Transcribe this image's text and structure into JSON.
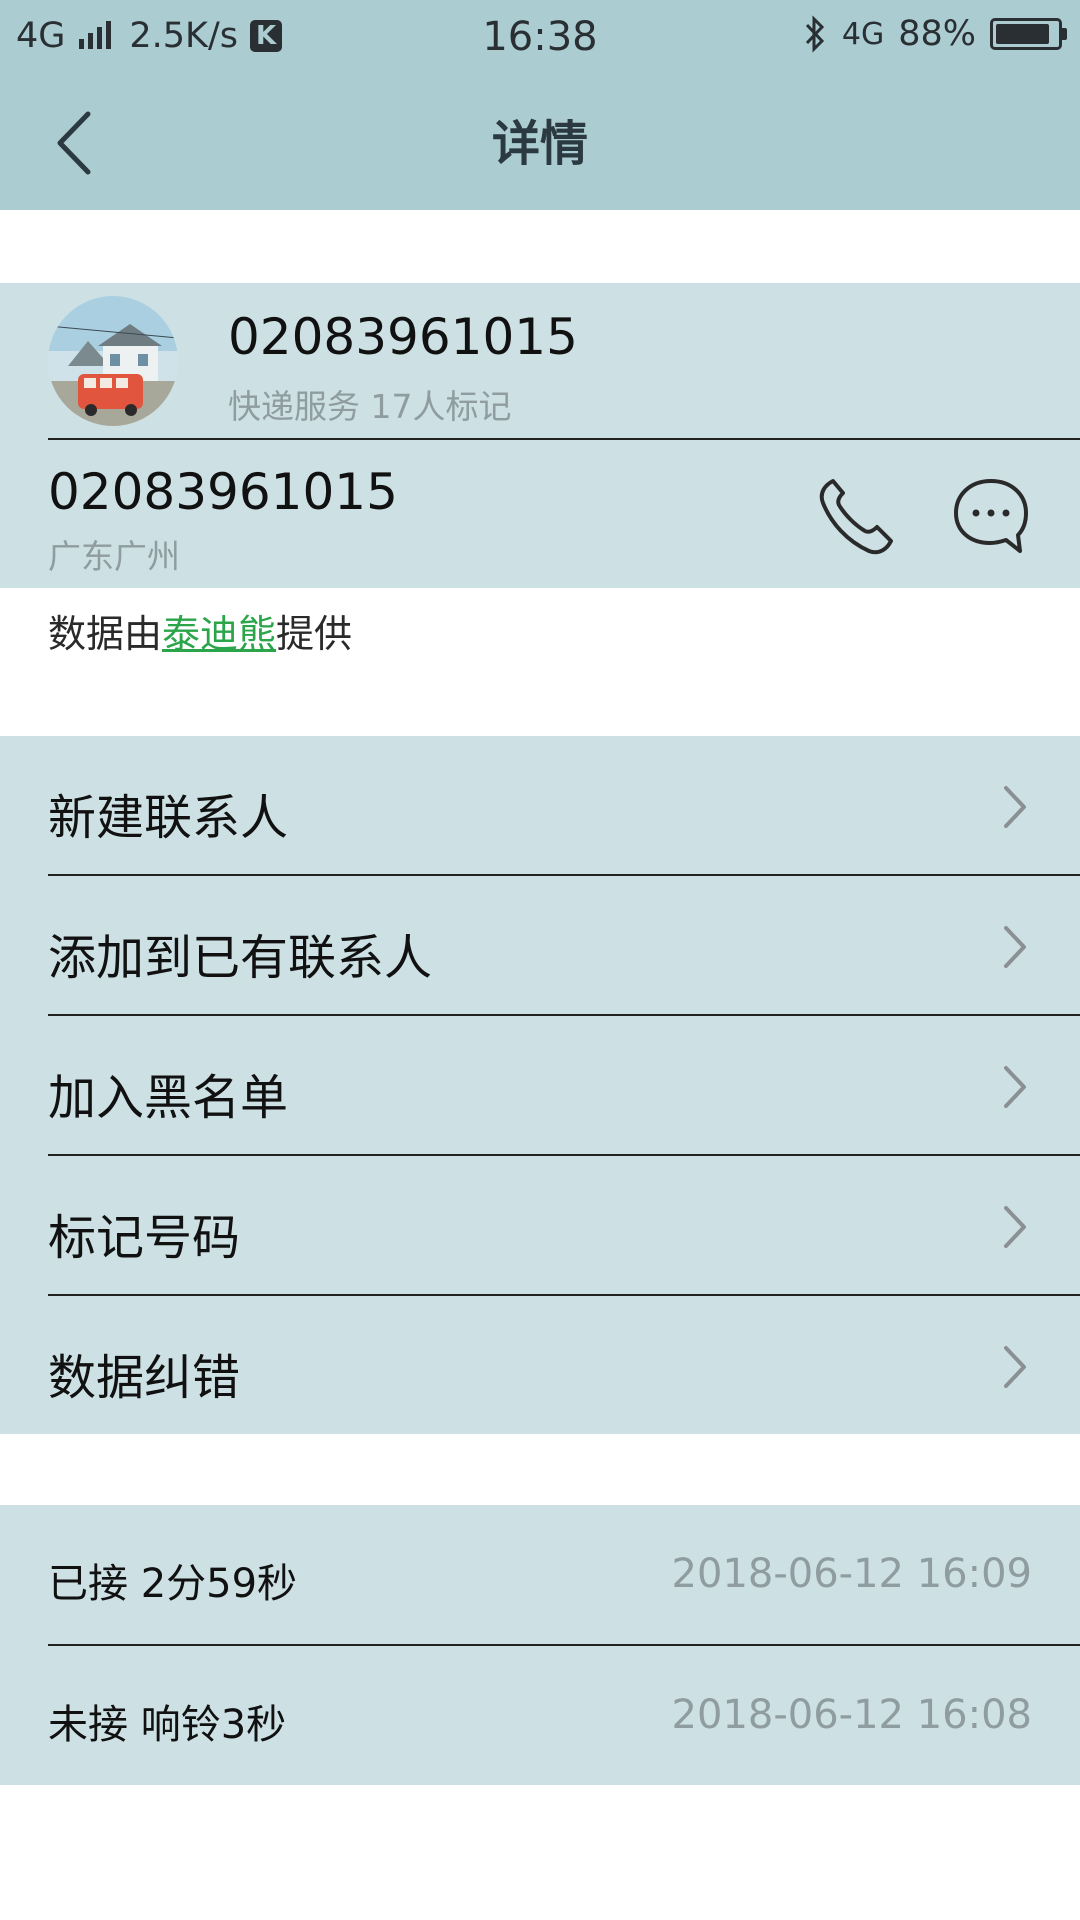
{
  "status_bar": {
    "network": "4G",
    "speed": "2.5K/s",
    "k_badge": "K",
    "time": "16:38",
    "net_right": "4G",
    "battery": "88%",
    "battery_level": 0.88
  },
  "header": {
    "title": "详情",
    "back_icon": "chevron-left-icon"
  },
  "contact": {
    "number": "02083961015",
    "tag": "快递服务 17人标记",
    "number_line": "02083961015",
    "location": "广东广州",
    "call_icon": "phone-icon",
    "message_icon": "message-bubble-icon"
  },
  "provider": {
    "prefix": "数据由",
    "link": "泰迪熊",
    "suffix": "提供"
  },
  "menu": {
    "items": [
      {
        "label": "新建联系人"
      },
      {
        "label": "添加到已有联系人"
      },
      {
        "label": "加入黑名单"
      },
      {
        "label": "标记号码"
      },
      {
        "label": "数据纠错"
      }
    ]
  },
  "call_log": [
    {
      "text": "已接 2分59秒",
      "time": "2018-06-12 16:09"
    },
    {
      "text": "未接 响铃3秒",
      "time": "2018-06-12 16:08"
    }
  ],
  "colors": {
    "header_bg": "#abcdd2",
    "section_bg": "#cde1e5",
    "link_green": "#2aa54a",
    "secondary_text": "#8f9ca0"
  }
}
